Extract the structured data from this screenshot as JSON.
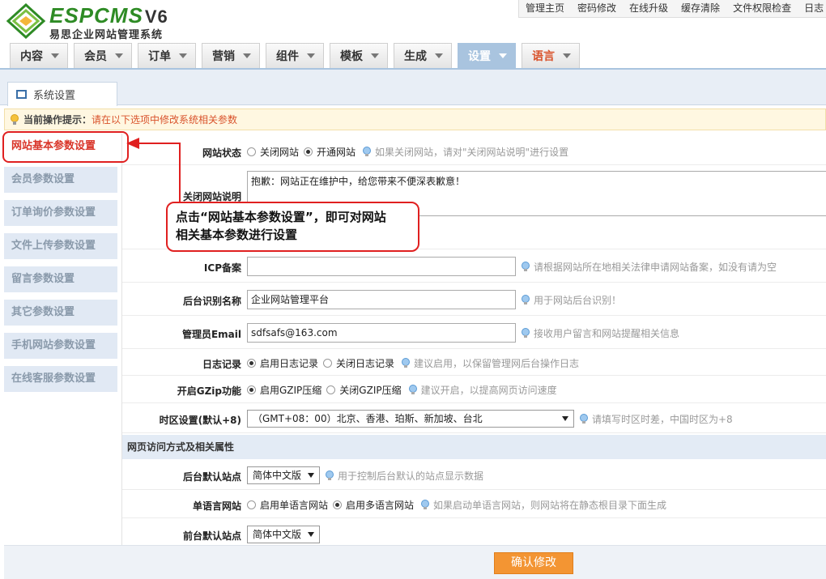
{
  "logo": {
    "brand": "ESPCMS",
    "version": "V6",
    "subtitle": "易思企业网站管理系统"
  },
  "toplinks": [
    "管理主页",
    "密码修改",
    "在线升级",
    "缓存清除",
    "文件权限检查",
    "日志"
  ],
  "nav": {
    "tabs": [
      {
        "label": "内容"
      },
      {
        "label": "会员"
      },
      {
        "label": "订单"
      },
      {
        "label": "营销"
      },
      {
        "label": "组件"
      },
      {
        "label": "模板"
      },
      {
        "label": "生成"
      },
      {
        "label": "设置"
      },
      {
        "label": "语言"
      }
    ],
    "active_tab": "设置",
    "lang_color": "#d9532c",
    "active_color": "#a9c4df"
  },
  "subtab": {
    "label": "系统设置"
  },
  "tip": {
    "label": "当前操作提示：",
    "text": "请在以下选项中修改系统相关参数"
  },
  "leftmenu": [
    "网站基本参数设置",
    "会员参数设置",
    "订单询价参数设置",
    "文件上传参数设置",
    "留言参数设置",
    "其它参数设置",
    "手机网站参数设置",
    "在线客服参数设置"
  ],
  "form": {
    "site_status": {
      "label": "网站状态",
      "opt_close": "关闭网站",
      "opt_open": "开通网站",
      "selected": "开通网站",
      "hint": "如果关闭网站，请对\"关闭网站说明\"进行设置"
    },
    "close_note": {
      "label": "关闭网站说明",
      "value": "抱歉：网站正在维护中，给您带来不便深表歉意！"
    },
    "icp": {
      "label": "ICP备案",
      "value": "",
      "hint": "请根据网站所在地相关法律申请网站备案，如没有请为空"
    },
    "admin_name": {
      "label": "后台识别名称",
      "value": "企业网站管理平台",
      "hint": "用于网站后台识别！"
    },
    "admin_email": {
      "label": "管理员Email",
      "value": "sdfsafs@163.com",
      "hint": "接收用户留言和网站提醒相关信息"
    },
    "log": {
      "label": "日志记录",
      "opt_on": "启用日志记录",
      "opt_off": "关闭日志记录",
      "selected": "启用日志记录",
      "hint": "建议启用，以保留管理网后台操作日志"
    },
    "gzip": {
      "label": "开启GZip功能",
      "opt_on": "启用GZIP压缩",
      "opt_off": "关闭GZIP压缩",
      "selected": "启用GZIP压缩",
      "hint": "建议开启，以提高网页访问速度"
    },
    "timezone": {
      "label": "时区设置(默认+8)",
      "value": "（GMT+08：00）北京、香港、珀斯、新加坡、台北",
      "hint": "请填写时区时差，中国时区为+8"
    },
    "section_title": "网页访问方式及相关属性",
    "admin_default_site": {
      "label": "后台默认站点",
      "value": "简体中文版",
      "hint": "用于控制后台默认的站点显示数据"
    },
    "single_lang": {
      "label": "单语言网站",
      "opt_single": "启用单语言网站",
      "opt_multi": "启用多语言网站",
      "selected": "启用多语言网站",
      "hint": "如果启动单语言网站，则网站将在静态根目录下面生成"
    },
    "front_default_site": {
      "label": "前台默认站点",
      "value": "简体中文版"
    }
  },
  "callout": {
    "line1": "点击“网站基本参数设置”，即可对网站",
    "line2": "相关基本参数进行设置",
    "color": "#e02020"
  },
  "submit": {
    "label": "确认修改",
    "color": "#f39533"
  }
}
